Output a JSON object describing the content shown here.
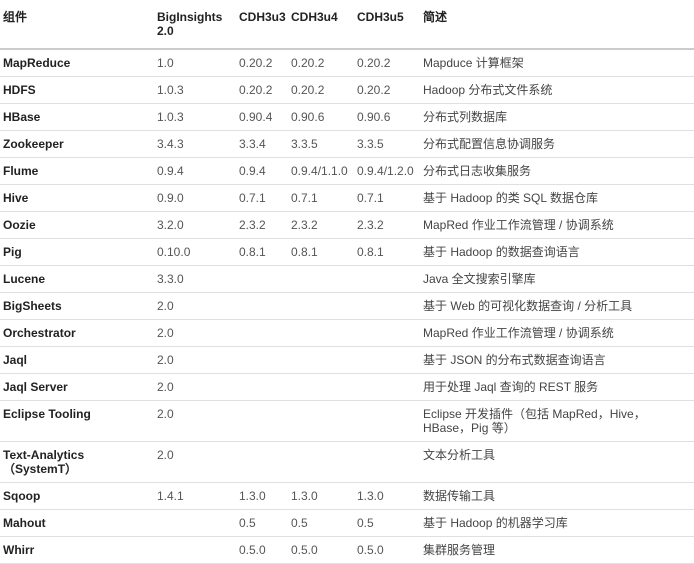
{
  "header": {
    "component": "组件",
    "biginsights": "BigInsights 2.0",
    "cdh3u3": "CDH3u3",
    "cdh3u4": "CDH3u4",
    "cdh3u5": "CDH3u5",
    "desc": "简述"
  },
  "rows": [
    {
      "name": "MapReduce",
      "bi": "1.0",
      "u3": "0.20.2",
      "u4": "0.20.2",
      "u5": "0.20.2",
      "desc": "Mapduce 计算框架"
    },
    {
      "name": "HDFS",
      "bi": "1.0.3",
      "u3": "0.20.2",
      "u4": "0.20.2",
      "u5": "0.20.2",
      "desc": "Hadoop 分布式文件系统"
    },
    {
      "name": "HBase",
      "bi": "1.0.3",
      "u3": "0.90.4",
      "u4": "0.90.6",
      "u5": "0.90.6",
      "desc": "分布式列数据库"
    },
    {
      "name": "Zookeeper",
      "bi": "3.4.3",
      "u3": "3.3.4",
      "u4": "3.3.5",
      "u5": "3.3.5",
      "desc": "分布式配置信息协调服务"
    },
    {
      "name": "Flume",
      "bi": "0.9.4",
      "u3": "0.9.4",
      "u4": "0.9.4/1.1.0",
      "u5": "0.9.4/1.2.0",
      "desc": "分布式日志收集服务"
    },
    {
      "name": "Hive",
      "bi": "0.9.0",
      "u3": "0.7.1",
      "u4": "0.7.1",
      "u5": "0.7.1",
      "desc": "基于 Hadoop 的类 SQL 数据仓库"
    },
    {
      "name": "Oozie",
      "bi": "3.2.0",
      "u3": "2.3.2",
      "u4": "2.3.2",
      "u5": "2.3.2",
      "desc": "MapRed 作业工作流管理 / 协调系统"
    },
    {
      "name": "Pig",
      "bi": "0.10.0",
      "u3": "0.8.1",
      "u4": "0.8.1",
      "u5": "0.8.1",
      "desc": "基于 Hadoop 的数据查询语言"
    },
    {
      "name": "Lucene",
      "bi": "3.3.0",
      "u3": "",
      "u4": "",
      "u5": "",
      "desc": "Java 全文搜索引擎库"
    },
    {
      "name": "BigSheets",
      "bi": "2.0",
      "u3": "",
      "u4": "",
      "u5": "",
      "desc": "基于 Web 的可视化数据查询 / 分析工具"
    },
    {
      "name": "Orchestrator",
      "bi": "2.0",
      "u3": "",
      "u4": "",
      "u5": "",
      "desc": "MapRed 作业工作流管理 / 协调系统"
    },
    {
      "name": "Jaql",
      "bi": "2.0",
      "u3": "",
      "u4": "",
      "u5": "",
      "desc": "基于 JSON 的分布式数据查询语言"
    },
    {
      "name": "Jaql Server",
      "bi": "2.0",
      "u3": "",
      "u4": "",
      "u5": "",
      "desc": "用于处理 Jaql 查询的 REST 服务"
    },
    {
      "name": "Eclipse Tooling",
      "bi": "2.0",
      "u3": "",
      "u4": "",
      "u5": "",
      "desc": "Eclipse 开发插件（包括 MapRed，Hive，HBase，Pig 等）"
    },
    {
      "name": "Text-Analytics（SystemT）",
      "bi": "2.0",
      "u3": "",
      "u4": "",
      "u5": "",
      "desc": "文本分析工具"
    },
    {
      "name": "Sqoop",
      "bi": "1.4.1",
      "u3": "1.3.0",
      "u4": "1.3.0",
      "u5": "1.3.0",
      "desc": "数据传输工具"
    },
    {
      "name": "Mahout",
      "bi": "",
      "u3": "0.5",
      "u4": "0.5",
      "u5": "0.5",
      "desc": "基于 Hadoop 的机器学习库"
    },
    {
      "name": "Whirr",
      "bi": "",
      "u3": "0.5.0",
      "u4": "0.5.0",
      "u5": "0.5.0",
      "desc": "集群服务管理"
    }
  ]
}
